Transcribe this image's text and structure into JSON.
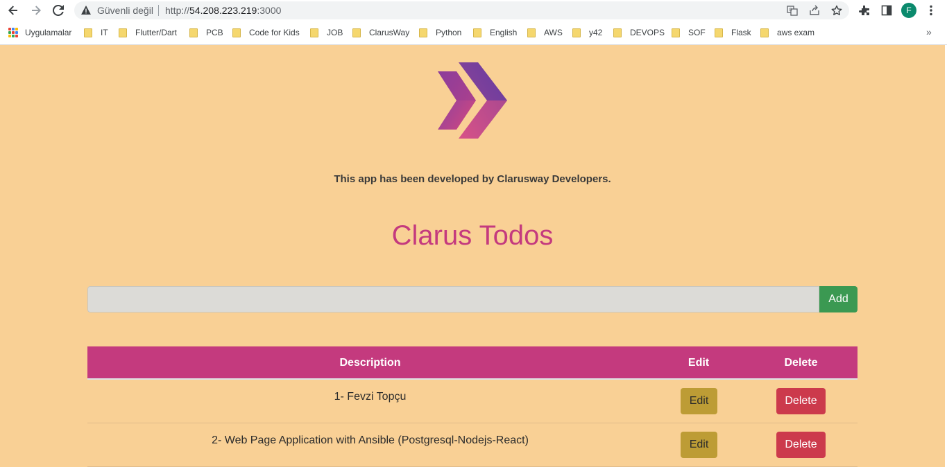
{
  "browser": {
    "security_label": "Güvenli değil",
    "url_scheme": "http://",
    "url_host": "54.208.223.219",
    "url_port": ":3000",
    "profile_initial": "F"
  },
  "bookmarks": {
    "apps_label": "Uygulamalar",
    "items": [
      "IT",
      "Flutter/Dart",
      "PCB",
      "Code for Kids",
      "JOB",
      "ClarusWay",
      "Python",
      "English",
      "AWS",
      "y42",
      "DEVOPS",
      "SOF",
      "Flask",
      "aws exam"
    ],
    "more": "»"
  },
  "app": {
    "developer_note": "This app has been developed by Clarusway Developers.",
    "title": "Clarus Todos",
    "input_value": "",
    "add_label": "Add",
    "columns": [
      "Description",
      "Edit",
      "Delete"
    ],
    "todos": [
      {
        "description": "1- Fevzi Topçu",
        "edit_label": "Edit",
        "delete_label": "Delete"
      },
      {
        "description": "2- Web Page Application with Ansible (Postgresql-Nodejs-React)",
        "edit_label": "Edit",
        "delete_label": "Delete"
      }
    ]
  },
  "colors": {
    "page_background": "#f9d095",
    "accent": "#c43a7e",
    "add_button": "#3b9952",
    "edit_button": "#bd9c35",
    "delete_button": "#cc3a4c"
  },
  "icons": [
    "back-icon",
    "forward-icon",
    "reload-icon",
    "warning-icon",
    "translate-icon",
    "share-icon",
    "star-icon",
    "extensions-icon",
    "side-panel-icon",
    "menu-icon",
    "apps-icon",
    "folder-icon",
    "clarusway-logo"
  ]
}
